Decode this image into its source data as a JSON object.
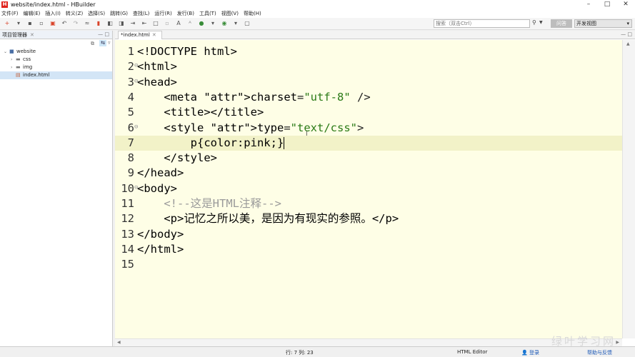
{
  "window": {
    "title": "website/index.html - HBuilder",
    "controls": [
      "–",
      "□",
      "✕"
    ]
  },
  "menu": [
    "文件(F)",
    "编辑(E)",
    "插入(I)",
    "转义(Z)",
    "选择(S)",
    "跳转(G)",
    "查找(L)",
    "运行(R)",
    "发行(B)",
    "工具(T)",
    "视图(V)",
    "帮助(H)"
  ],
  "toolbar": {
    "search_placeholder": "搜索（双击Ctrl）",
    "qa_label": "问答",
    "perspective": "开发视图"
  },
  "project_panel": {
    "title": "项目管理器",
    "tree": [
      {
        "label": "website",
        "level": 0,
        "expanded": true,
        "icon": "project-icon"
      },
      {
        "label": "css",
        "level": 1,
        "expanded": false,
        "icon": "folder-icon"
      },
      {
        "label": "img",
        "level": 1,
        "expanded": false,
        "icon": "folder-icon"
      },
      {
        "label": "index.html",
        "level": 1,
        "selected": true,
        "icon": "html-file-icon"
      }
    ]
  },
  "editor": {
    "tab_label": "*index.html",
    "lines": [
      "<!DOCTYPE html>",
      "<html>",
      "<head>",
      "    <meta charset=\"utf-8\" />",
      "    <title></title>",
      "    <style type=\"text/css\">",
      "        p{color:pink;}",
      "    </style>",
      "</head>",
      "<body>",
      "    <!--这是HTML注释-->",
      "    <p>记忆之所以美，是因为有现实的参照。</p>",
      "</body>",
      "</html>",
      ""
    ],
    "current_line": 7
  },
  "status": {
    "position": "行: 7 列: 23",
    "mode": "HTML Editor",
    "login": "登录",
    "help": "帮助与反馈"
  },
  "watermark": "绿叶学习网"
}
